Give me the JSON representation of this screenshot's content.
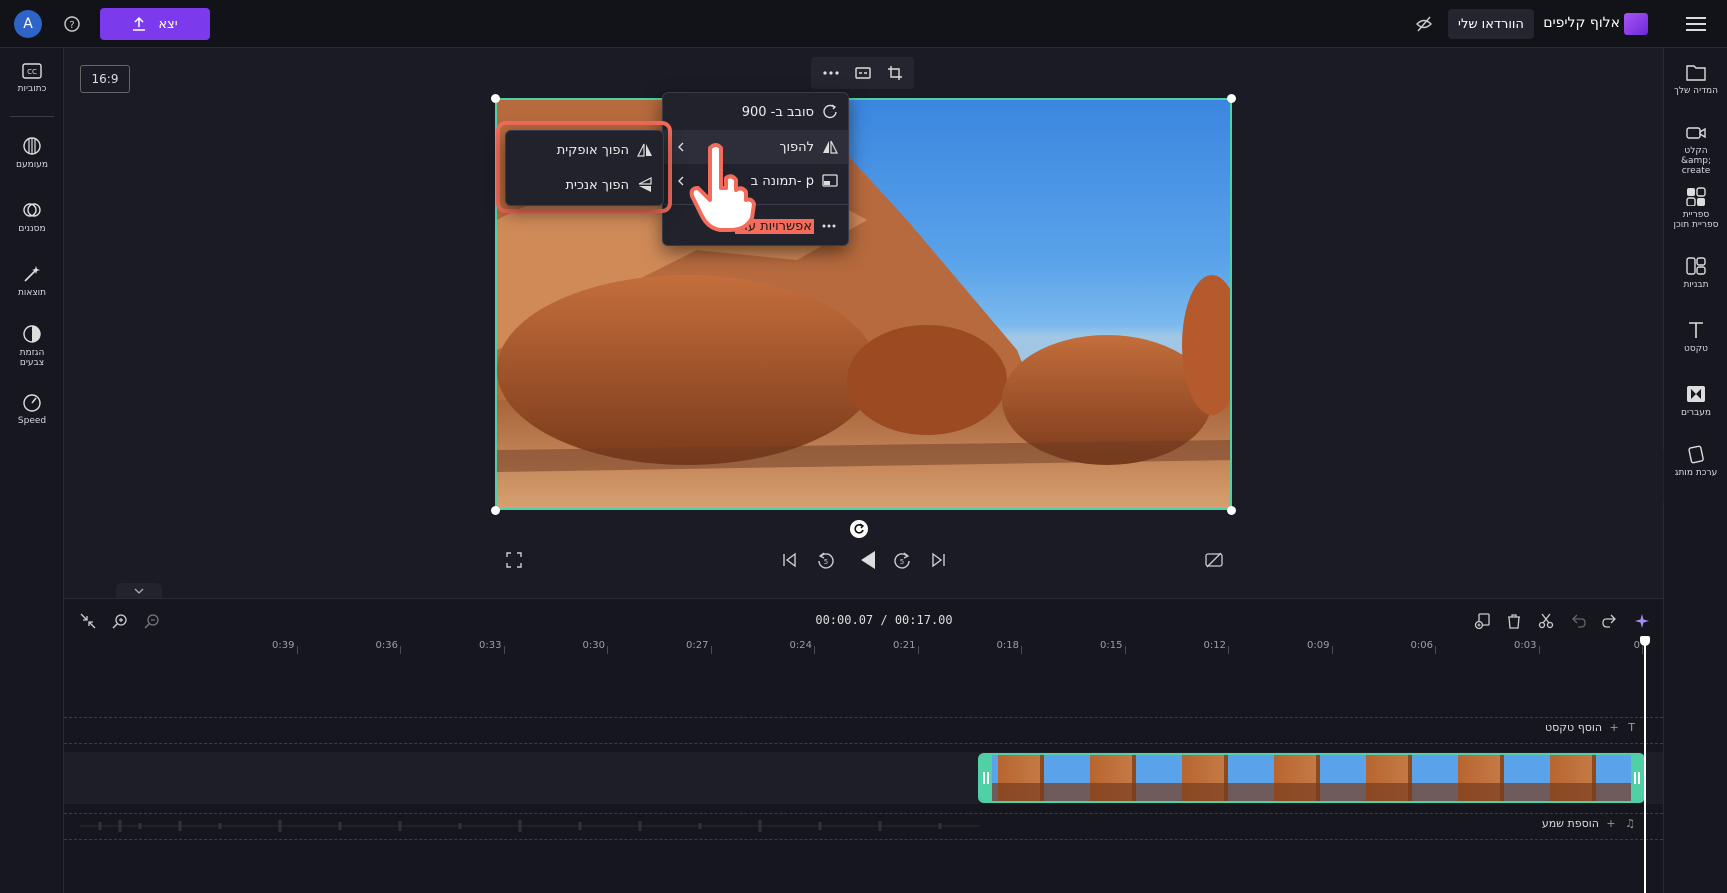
{
  "app": {
    "name": "אלוף קליפים",
    "avatar_letter": "A"
  },
  "topbar": {
    "my_videos": "הוורדאו שלי",
    "export_label": "יצא"
  },
  "canvas": {
    "aspect_ratio": "16:9"
  },
  "left_rail": {
    "items": [
      "כתוביות",
      "מעומעם",
      "מסננים",
      "תוצאות",
      "הגזמת צבעים",
      "Speed"
    ]
  },
  "right_rail": {
    "items": [
      "המדיה שלך",
      "הקלט &amp; create",
      "ספריית ספריית תוכן",
      "תבניות",
      "טקסט",
      "מעברים",
      "ערכת מותג"
    ]
  },
  "context_menu": {
    "items": [
      "סובב ב- 900",
      "להפוך",
      "תמונה ב- p",
      "אפשרויות עוד"
    ]
  },
  "submenu": {
    "items": [
      "הפוך אופקית",
      "הפוך אנכית"
    ]
  },
  "timeline": {
    "time_display": "00:00.07 / 00:17.00",
    "ticks": [
      "0",
      "0:03",
      "0:06",
      "0:09",
      "0:12",
      "0:15",
      "0:18",
      "0:21",
      "0:24",
      "0:27",
      "0:30",
      "0:33",
      "0:36",
      "0:39"
    ],
    "add_text": "הוסף טקסט",
    "add_audio": "הוספת שמע"
  },
  "colors": {
    "accent": "#7c3aed",
    "selection": "#4fd1a5",
    "highlight": "#f26b5b",
    "background": "#16161f"
  }
}
